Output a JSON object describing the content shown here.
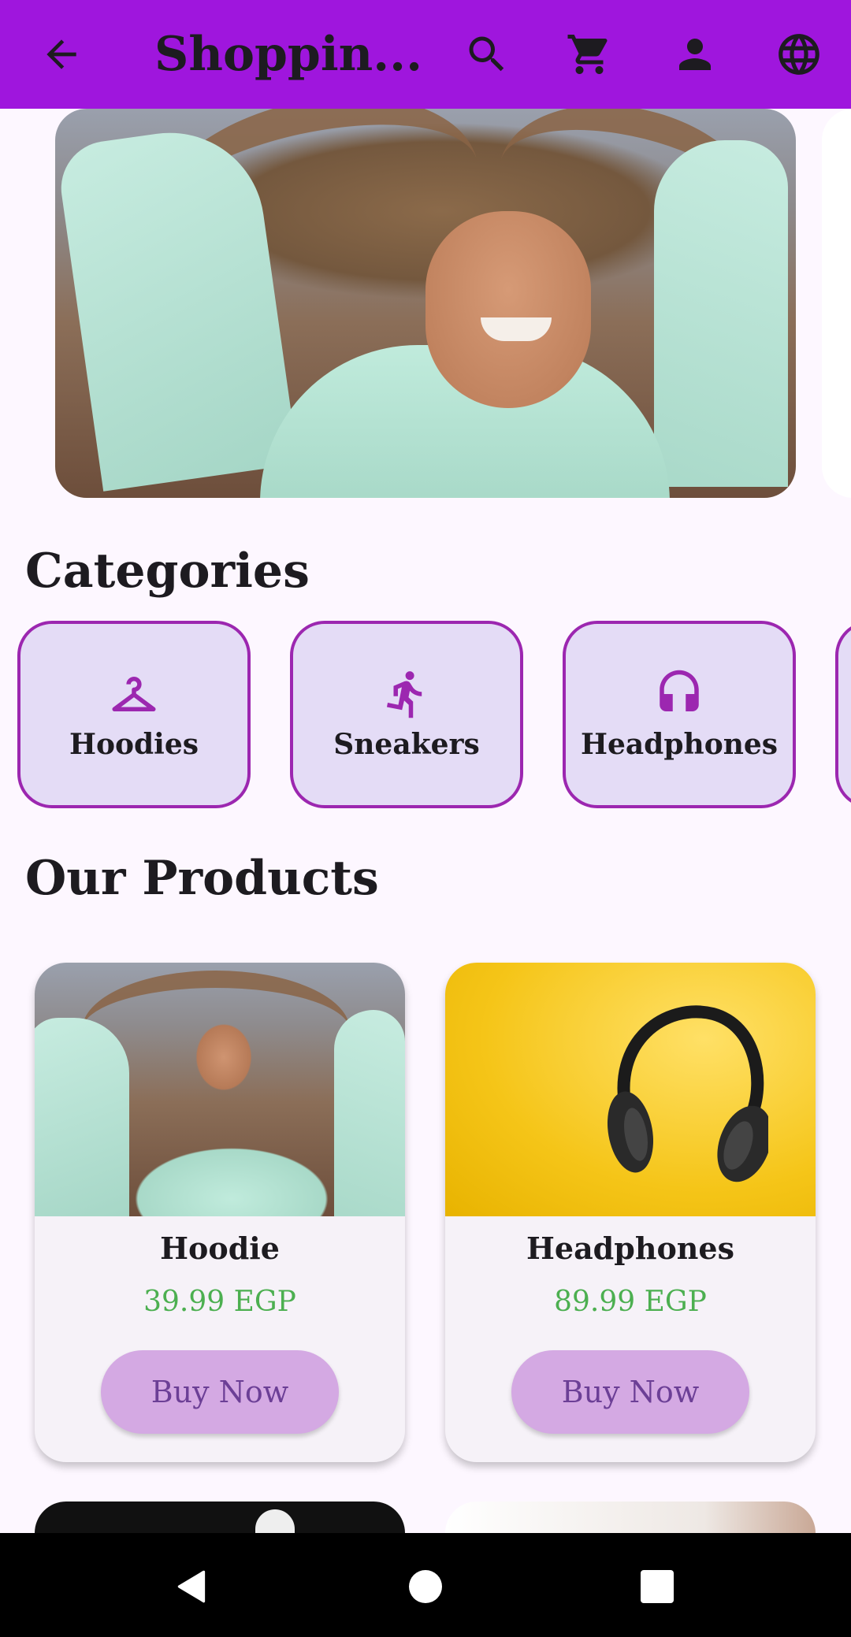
{
  "appbar": {
    "title": "Shoppin...",
    "background": "#9f16dd",
    "icons": [
      "arrow-back-icon",
      "search-icon",
      "cart-icon",
      "person-icon",
      "globe-icon"
    ]
  },
  "sections": {
    "categories_title": "Categories",
    "products_title": "Our Products"
  },
  "categories": [
    {
      "label": "Hoodies",
      "icon": "hanger-icon"
    },
    {
      "label": "Sneakers",
      "icon": "running-icon"
    },
    {
      "label": "Headphones",
      "icon": "headphones-icon"
    }
  ],
  "products": [
    {
      "name": "Hoodie",
      "price": "39.99 EGP",
      "button": "Buy Now"
    },
    {
      "name": "Headphones",
      "price": "89.99 EGP",
      "button": "Buy Now"
    }
  ],
  "colors": {
    "accent": "#9c27b0",
    "price": "#4caf50",
    "button_bg": "#d4a9e3",
    "category_bg": "#e4dcf6"
  }
}
